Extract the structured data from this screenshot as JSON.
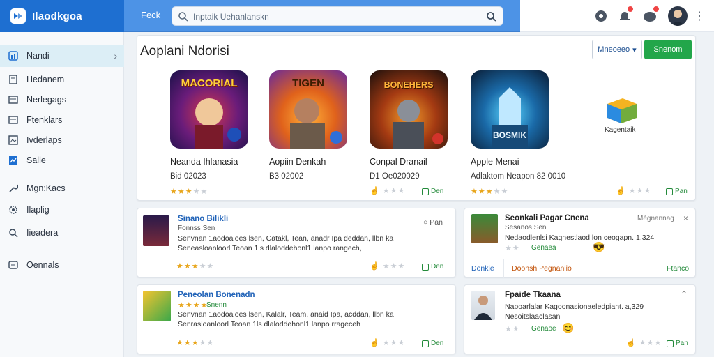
{
  "brand": {
    "title": "Ilaodkgoa"
  },
  "topbar": {
    "label": "Feck",
    "search_placeholder": "Inptaik Uehanlanskn"
  },
  "sidebar": {
    "items": [
      {
        "label": "Nandi",
        "icon": "bar-chart-icon"
      },
      {
        "label": "Hedanem",
        "icon": "doc-icon"
      },
      {
        "label": "Nerlegags",
        "icon": "list-icon"
      },
      {
        "label": "Ftenklars",
        "icon": "list-icon"
      },
      {
        "label": "Ivderlaps",
        "icon": "picture-icon"
      },
      {
        "label": "Salle",
        "icon": "chart-line-icon"
      },
      {
        "label": "Mgn:Kacs",
        "icon": "wrench-icon"
      },
      {
        "label": "Ilaplig",
        "icon": "gear-icon"
      },
      {
        "label": "Iieadera",
        "icon": "search-icon"
      },
      {
        "label": "Oennals",
        "icon": "box-icon"
      }
    ]
  },
  "main": {
    "title": "Aoplani Ndorisi",
    "sort_label": "Mneoeeo",
    "search_label": "Snenom",
    "apps": [
      {
        "art_text": "MACORIAL",
        "name": "Neanda Ihlanasia",
        "version": "Bid 02023",
        "stars": 3
      },
      {
        "art_text": "TIGEN",
        "name": "Aopiin Denkah",
        "version": "B3 02002",
        "stars": 0,
        "dl": "Den"
      },
      {
        "art_text": "BONEHERS",
        "name": "Conpal Dranail",
        "version": "D1 Oe020029",
        "stars": 0,
        "dl": "Den"
      },
      {
        "art_text": "BOSMIK",
        "name": "Apple Menai",
        "version": "Adlaktom Neapon 82 0010",
        "stars": 3
      },
      {
        "name": "Kagentaik",
        "dl": "Pan"
      }
    ]
  },
  "reviews": [
    {
      "title": "Sinano Bilikli",
      "sub": "Fonnss Sen",
      "body1": "Senvnan 1aodoaloes lsen, Catakl, Tean, anadr Ipa deddan, llbn ka",
      "body2": "Seneasloanloorl Teoan 1ls dlaloddehonl1 lanpo rangech,",
      "action": "Pan",
      "dl": "Den"
    },
    {
      "title": "Seonkali Pagar Cnena",
      "menu": "Mégnannag",
      "sub": "Sesanos Sen",
      "body": "Nedaodlenlsi Kagnestlaod lon ceogapn. 1,324",
      "rating_label": "Genaea",
      "tab1": "Donkie",
      "tab2": "Doonsh Pegnanlio",
      "tab3": "Ftanco"
    },
    {
      "title": "Peneolan Bonenadn",
      "sub": "Snenn",
      "body1": "Senvnan 1aodoaloes lsen, Kalalr, Team, anaid Ipa, acddan, llbn ka",
      "body2": "Senrasloanloorl Teoan 1ls dlaloddehonl1 lanpo rrageceh",
      "dl": "Den"
    },
    {
      "title": "Fpaide Tkaana",
      "body": "Napoarlalar Kagoonasionaeledpiant. a,329",
      "body2": "Nesoitslaaclasan",
      "rating_label": "Genaoe",
      "dl": "Pan"
    }
  ],
  "colors": {
    "brand": "#1e6fd1",
    "accent": "#22a64a",
    "star": "#e8a51a"
  }
}
